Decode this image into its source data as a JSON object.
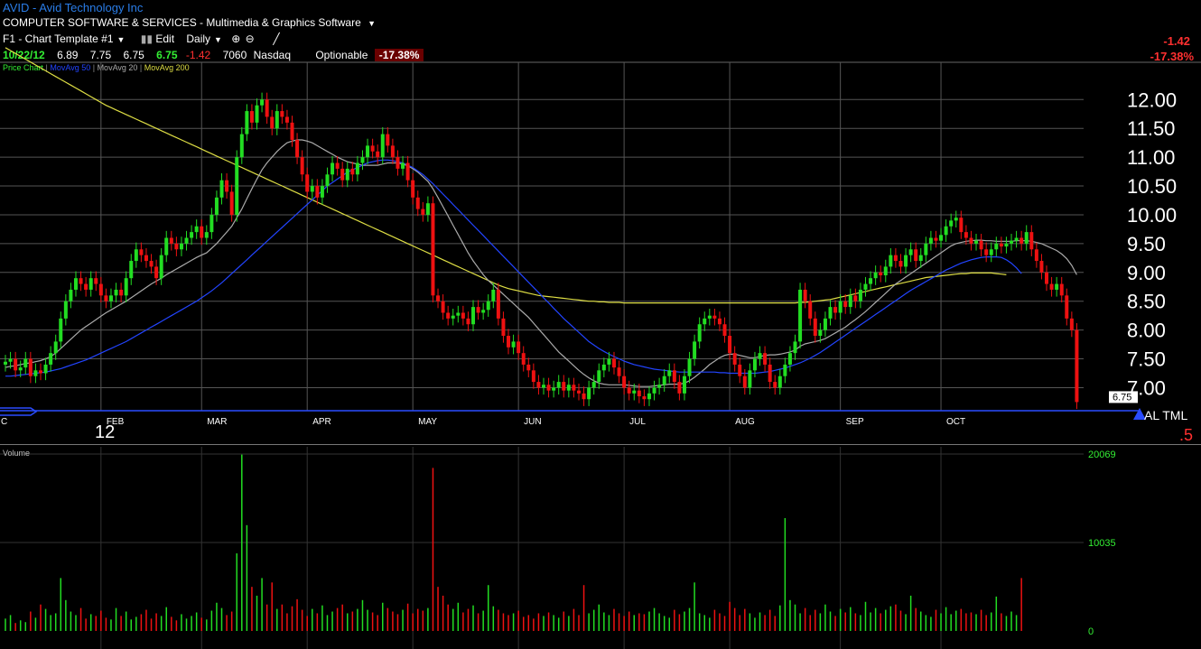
{
  "header": {
    "symbol": "AVID",
    "company": "Avid Technology Inc",
    "sector": "COMPUTER SOFTWARE & SERVICES - Multimedia & Graphics Software",
    "template": "F1 - Chart Template #1",
    "edit_label": "Edit",
    "period_label": "Daily",
    "quote_date": "10/22/12",
    "open": "6.89",
    "high": "7.75",
    "low": "6.75",
    "last": "6.75",
    "change": "-1.42",
    "volume": "7060",
    "exchange": "Nasdaq",
    "optionable": "Optionable",
    "change_pct": "-17.38%",
    "right_change": "-1.42",
    "right_change_pct": "-17.38%"
  },
  "legend": {
    "price_chart": "Price Chart",
    "ma50": "MovAvg 50",
    "ma20": "MovAvg 20",
    "ma200": "MovAvg 200",
    "ma50_color": "#2244ff",
    "ma20_color": "#aaaaaa",
    "ma200_color": "#dddd44"
  },
  "colors": {
    "up": "#22dd22",
    "down": "#ee1111",
    "grid": "#555555",
    "axis": "#2a4cff"
  },
  "extra": {
    "corner_label": "12",
    "lower_right": ".5",
    "right_tags": "AL TML",
    "vol_title": "Volume"
  },
  "chart_data": [
    {
      "type": "candlestick",
      "ylim": [
        6.6,
        12.6
      ],
      "yticks": [
        "12.00",
        "11.50",
        "11.00",
        "10.50",
        "10.00",
        "9.50",
        "9.00",
        "8.50",
        "8.00",
        "7.50",
        "7.00"
      ],
      "ytick_values": [
        12.0,
        11.5,
        11.0,
        10.5,
        10.0,
        9.5,
        9.0,
        8.5,
        8.0,
        7.5,
        7.0
      ],
      "months": [
        "C",
        "FEB",
        "MAR",
        "APR",
        "MAY",
        "JUN",
        "JUL",
        "AUG",
        "SEP",
        "OCT"
      ],
      "last_price_label": "6.75",
      "close": [
        7.45,
        7.5,
        7.3,
        7.35,
        7.5,
        7.2,
        7.3,
        7.25,
        7.4,
        7.6,
        7.8,
        8.2,
        8.5,
        8.7,
        8.9,
        8.8,
        8.7,
        8.9,
        8.8,
        8.6,
        8.5,
        8.6,
        8.7,
        8.6,
        8.9,
        9.2,
        9.4,
        9.3,
        9.2,
        9.1,
        8.9,
        9.3,
        9.6,
        9.5,
        9.4,
        9.5,
        9.6,
        9.7,
        9.8,
        9.6,
        9.7,
        10.0,
        10.3,
        10.6,
        10.4,
        10.0,
        11.0,
        11.4,
        11.8,
        11.6,
        11.9,
        12.0,
        11.7,
        11.5,
        11.8,
        11.7,
        11.6,
        11.3,
        11.0,
        10.7,
        10.4,
        10.5,
        10.3,
        10.5,
        10.7,
        10.9,
        10.8,
        10.6,
        10.8,
        10.7,
        10.9,
        11.0,
        11.2,
        11.1,
        11.0,
        11.4,
        11.2,
        11.0,
        10.8,
        10.9,
        10.6,
        10.3,
        10.1,
        10.0,
        10.2,
        8.6,
        8.5,
        8.3,
        8.2,
        8.25,
        8.3,
        8.2,
        8.1,
        8.4,
        8.3,
        8.35,
        8.5,
        8.7,
        8.2,
        7.9,
        7.7,
        7.8,
        7.6,
        7.4,
        7.3,
        7.1,
        7.0,
        7.05,
        6.95,
        7.0,
        7.1,
        6.95,
        7.05,
        6.95,
        6.9,
        6.8,
        7.0,
        7.1,
        7.3,
        7.4,
        7.5,
        7.35,
        7.2,
        7.0,
        6.9,
        6.95,
        6.85,
        6.8,
        6.9,
        7.0,
        7.05,
        7.2,
        7.3,
        7.1,
        6.9,
        7.2,
        7.5,
        7.8,
        8.1,
        8.2,
        8.25,
        8.2,
        8.1,
        7.9,
        7.6,
        7.4,
        7.2,
        7.0,
        7.3,
        7.5,
        7.6,
        7.4,
        7.1,
        7.0,
        7.2,
        7.4,
        7.6,
        7.8,
        8.7,
        8.5,
        8.2,
        7.9,
        8.0,
        8.2,
        8.4,
        8.3,
        8.5,
        8.4,
        8.6,
        8.5,
        8.7,
        8.8,
        8.9,
        9.0,
        8.95,
        9.1,
        9.3,
        9.2,
        9.1,
        9.3,
        9.4,
        9.2,
        9.3,
        9.5,
        9.6,
        9.55,
        9.65,
        9.8,
        9.9,
        9.95,
        9.7,
        9.6,
        9.5,
        9.55,
        9.4,
        9.3,
        9.4,
        9.5,
        9.45,
        9.5,
        9.55,
        9.6,
        9.5,
        9.7,
        9.4,
        9.2,
        9.0,
        8.8,
        8.7,
        8.8,
        8.6,
        8.2,
        8.0,
        6.75
      ],
      "ma20": [
        7.35,
        7.37,
        7.38,
        7.4,
        7.42,
        7.43,
        7.45,
        7.47,
        7.5,
        7.54,
        7.6,
        7.68,
        7.76,
        7.84,
        7.92,
        8.0,
        8.06,
        8.12,
        8.18,
        8.24,
        8.3,
        8.35,
        8.4,
        8.45,
        8.5,
        8.56,
        8.62,
        8.68,
        8.74,
        8.8,
        8.85,
        8.9,
        8.96,
        9.01,
        9.06,
        9.11,
        9.16,
        9.21,
        9.26,
        9.3,
        9.34,
        9.42,
        9.5,
        9.6,
        9.7,
        9.8,
        9.95,
        10.1,
        10.28,
        10.45,
        10.62,
        10.78,
        10.9,
        11.0,
        11.1,
        11.18,
        11.25,
        11.28,
        11.3,
        11.3,
        11.28,
        11.25,
        11.2,
        11.15,
        11.1,
        11.05,
        11.0,
        10.96,
        10.92,
        10.9,
        10.88,
        10.86,
        10.86,
        10.86,
        10.86,
        10.88,
        10.9,
        10.9,
        10.9,
        10.88,
        10.85,
        10.8,
        10.74,
        10.66,
        10.58,
        10.45,
        10.3,
        10.14,
        9.98,
        9.82,
        9.66,
        9.5,
        9.34,
        9.2,
        9.08,
        8.96,
        8.86,
        8.78,
        8.7,
        8.62,
        8.54,
        8.46,
        8.38,
        8.3,
        8.22,
        8.12,
        8.02,
        7.92,
        7.82,
        7.72,
        7.62,
        7.54,
        7.46,
        7.38,
        7.3,
        7.23,
        7.17,
        7.12,
        7.08,
        7.06,
        7.05,
        7.05,
        7.05,
        7.05,
        7.04,
        7.03,
        7.02,
        7.02,
        7.02,
        7.03,
        7.04,
        7.05,
        7.06,
        7.06,
        7.06,
        7.08,
        7.12,
        7.18,
        7.25,
        7.32,
        7.4,
        7.46,
        7.52,
        7.56,
        7.58,
        7.58,
        7.56,
        7.54,
        7.52,
        7.52,
        7.54,
        7.56,
        7.57,
        7.57,
        7.58,
        7.6,
        7.62,
        7.65,
        7.72,
        7.76,
        7.78,
        7.8,
        7.82,
        7.85,
        7.9,
        7.95,
        8.0,
        8.05,
        8.12,
        8.18,
        8.25,
        8.32,
        8.4,
        8.48,
        8.56,
        8.64,
        8.72,
        8.8,
        8.86,
        8.92,
        8.98,
        9.04,
        9.1,
        9.16,
        9.22,
        9.28,
        9.34,
        9.4,
        9.46,
        9.5,
        9.52,
        9.54,
        9.55,
        9.56,
        9.56,
        9.55,
        9.55,
        9.54,
        9.54,
        9.54,
        9.54,
        9.55,
        9.55,
        9.55,
        9.54,
        9.52,
        9.5,
        9.46,
        9.42,
        9.38,
        9.32,
        9.24,
        9.12,
        8.96
      ],
      "ma50": [
        7.2,
        7.2,
        7.21,
        7.22,
        7.23,
        7.24,
        7.25,
        7.26,
        7.27,
        7.29,
        7.31,
        7.33,
        7.36,
        7.39,
        7.42,
        7.45,
        7.48,
        7.52,
        7.56,
        7.6,
        7.64,
        7.68,
        7.72,
        7.76,
        7.8,
        7.85,
        7.9,
        7.95,
        8.0,
        8.05,
        8.1,
        8.15,
        8.2,
        8.25,
        8.3,
        8.35,
        8.4,
        8.45,
        8.5,
        8.56,
        8.62,
        8.68,
        8.75,
        8.82,
        8.9,
        8.98,
        9.06,
        9.14,
        9.22,
        9.3,
        9.38,
        9.46,
        9.54,
        9.62,
        9.7,
        9.78,
        9.86,
        9.94,
        10.02,
        10.1,
        10.18,
        10.26,
        10.34,
        10.42,
        10.5,
        10.56,
        10.62,
        10.68,
        10.74,
        10.78,
        10.82,
        10.86,
        10.9,
        10.92,
        10.94,
        10.95,
        10.95,
        10.94,
        10.92,
        10.9,
        10.86,
        10.82,
        10.76,
        10.7,
        10.62,
        10.54,
        10.45,
        10.36,
        10.27,
        10.18,
        10.09,
        10.0,
        9.91,
        9.82,
        9.73,
        9.64,
        9.55,
        9.46,
        9.37,
        9.28,
        9.19,
        9.1,
        9.01,
        8.92,
        8.83,
        8.74,
        8.65,
        8.56,
        8.47,
        8.38,
        8.29,
        8.2,
        8.12,
        8.04,
        7.96,
        7.88,
        7.8,
        7.74,
        7.68,
        7.63,
        7.58,
        7.54,
        7.5,
        7.46,
        7.43,
        7.4,
        7.38,
        7.36,
        7.34,
        7.32,
        7.31,
        7.3,
        7.29,
        7.28,
        7.27,
        7.27,
        7.27,
        7.27,
        7.27,
        7.27,
        7.27,
        7.27,
        7.26,
        7.26,
        7.25,
        7.25,
        7.25,
        7.25,
        7.25,
        7.25,
        7.26,
        7.27,
        7.28,
        7.3,
        7.32,
        7.34,
        7.37,
        7.4,
        7.43,
        7.47,
        7.51,
        7.56,
        7.61,
        7.67,
        7.73,
        7.79,
        7.85,
        7.91,
        7.97,
        8.03,
        8.09,
        8.15,
        8.21,
        8.27,
        8.33,
        8.39,
        8.45,
        8.51,
        8.57,
        8.63,
        8.69,
        8.74,
        8.79,
        8.84,
        8.89,
        8.94,
        8.99,
        9.04,
        9.08,
        9.12,
        9.16,
        9.19,
        9.22,
        9.24,
        9.26,
        9.27,
        9.27,
        9.27,
        9.26,
        9.22,
        9.16,
        9.08,
        8.98
      ],
      "ma200": [
        12.9,
        12.85,
        12.8,
        12.75,
        12.7,
        12.65,
        12.6,
        12.55,
        12.5,
        12.45,
        12.4,
        12.35,
        12.3,
        12.25,
        12.2,
        12.15,
        12.1,
        12.05,
        12.0,
        11.95,
        11.9,
        11.86,
        11.82,
        11.78,
        11.74,
        11.7,
        11.66,
        11.62,
        11.58,
        11.54,
        11.5,
        11.46,
        11.42,
        11.38,
        11.34,
        11.3,
        11.26,
        11.22,
        11.18,
        11.14,
        11.1,
        11.06,
        11.02,
        10.98,
        10.94,
        10.9,
        10.86,
        10.82,
        10.78,
        10.74,
        10.7,
        10.66,
        10.62,
        10.58,
        10.54,
        10.5,
        10.46,
        10.42,
        10.38,
        10.34,
        10.3,
        10.26,
        10.22,
        10.18,
        10.14,
        10.1,
        10.06,
        10.02,
        9.98,
        9.94,
        9.9,
        9.86,
        9.82,
        9.78,
        9.74,
        9.7,
        9.66,
        9.62,
        9.58,
        9.54,
        9.5,
        9.46,
        9.42,
        9.38,
        9.34,
        9.3,
        9.26,
        9.22,
        9.18,
        9.14,
        9.1,
        9.06,
        9.02,
        8.98,
        8.94,
        8.9,
        8.86,
        8.82,
        8.78,
        8.75,
        8.72,
        8.7,
        8.68,
        8.66,
        8.64,
        8.62,
        8.6,
        8.59,
        8.58,
        8.57,
        8.56,
        8.55,
        8.54,
        8.53,
        8.52,
        8.51,
        8.5,
        8.5,
        8.49,
        8.49,
        8.48,
        8.48,
        8.48,
        8.47,
        8.47,
        8.47,
        8.47,
        8.47,
        8.47,
        8.47,
        8.47,
        8.47,
        8.47,
        8.47,
        8.47,
        8.47,
        8.47,
        8.47,
        8.47,
        8.47,
        8.47,
        8.47,
        8.47,
        8.47,
        8.47,
        8.47,
        8.47,
        8.47,
        8.47,
        8.47,
        8.47,
        8.47,
        8.47,
        8.47,
        8.47,
        8.47,
        8.47,
        8.47,
        8.48,
        8.48,
        8.49,
        8.5,
        8.51,
        8.52,
        8.53,
        8.55,
        8.57,
        8.59,
        8.61,
        8.63,
        8.65,
        8.67,
        8.69,
        8.71,
        8.73,
        8.75,
        8.77,
        8.79,
        8.81,
        8.83,
        8.85,
        8.87,
        8.89,
        8.91,
        8.92,
        8.93,
        8.94,
        8.95,
        8.96,
        8.97,
        8.98,
        8.98,
        8.99,
        8.99,
        8.99,
        8.99,
        8.99,
        8.98,
        8.97,
        8.96
      ]
    },
    {
      "type": "bar",
      "title": "Volume",
      "ylim": [
        0,
        20069
      ],
      "yticks": [
        "20069",
        "10035",
        "0"
      ],
      "ytick_values": [
        20069,
        10035,
        0
      ],
      "volume": [
        1400,
        1800,
        900,
        1200,
        1000,
        2200,
        1500,
        3000,
        2500,
        1800,
        2000,
        6000,
        3500,
        2200,
        1800,
        2600,
        1400,
        1900,
        1700,
        2300,
        1500,
        1300,
        2600,
        1700,
        2200,
        1300,
        1600,
        1900,
        2400,
        1400,
        2000,
        1700,
        2700,
        1600,
        1200,
        1900,
        1400,
        1700,
        2100,
        1500,
        1300,
        2300,
        3200,
        2600,
        1800,
        2200,
        8800,
        20000,
        12000,
        5000,
        4000,
        6000,
        3000,
        5500,
        2500,
        3000,
        2000,
        2800,
        3600,
        2400,
        1700,
        2500,
        2000,
        2900,
        1800,
        2200,
        2600,
        3000,
        2000,
        2200,
        2500,
        3500,
        2400,
        2100,
        1800,
        3200,
        2600,
        2200,
        1900,
        2400,
        3100,
        2000,
        2500,
        2300,
        2600,
        18500,
        5000,
        4000,
        3000,
        2500,
        3200,
        2100,
        2500,
        2900,
        2000,
        2300,
        5200,
        2800,
        2400,
        2000,
        1800,
        2000,
        2300,
        1600,
        1800,
        1400,
        2000,
        1700,
        2100,
        1800,
        1500,
        2200,
        1700,
        2500,
        1800,
        5200,
        2000,
        2400,
        3000,
        2100,
        1800,
        2500,
        2000,
        1700,
        2200,
        1800,
        2000,
        1900,
        2200,
        2600,
        2000,
        1700,
        1500,
        2400,
        1900,
        2200,
        2600,
        5500,
        2000,
        1800,
        1500,
        2400,
        2000,
        1700,
        3300,
        2600,
        1800,
        2500,
        2000,
        1500,
        2100,
        1800,
        2400,
        1700,
        2900,
        12800,
        3500,
        3000,
        2000,
        2600,
        1800,
        2400,
        2000,
        3000,
        2200,
        1700,
        2500,
        2100,
        2700,
        2000,
        1800,
        3300,
        2100,
        2600,
        2000,
        2400,
        2800,
        3000,
        2300,
        1900,
        4000,
        2600,
        2200,
        1800,
        1600,
        2400,
        2000,
        2700,
        1900,
        2300,
        2500,
        2000,
        2100,
        1900,
        2400,
        1800,
        2100,
        3900,
        2000,
        1700,
        2200,
        1800,
        6000
      ]
    }
  ]
}
